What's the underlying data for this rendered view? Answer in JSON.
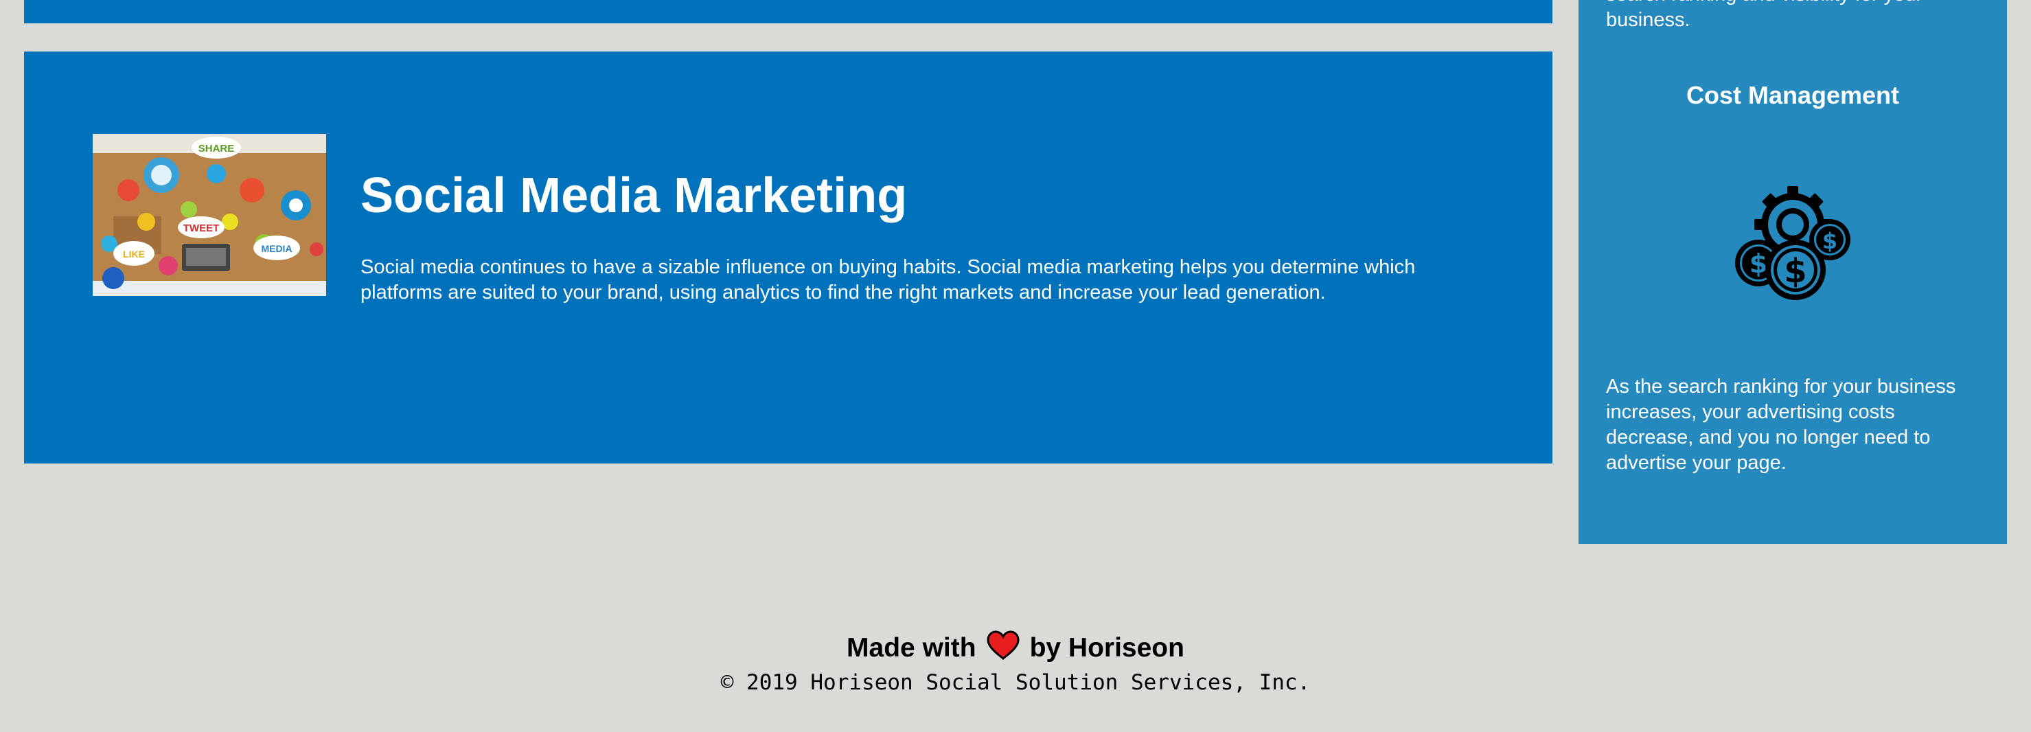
{
  "content": {
    "social_media": {
      "title": "Social Media Marketing",
      "text": "Social media continues to have a sizable influence on buying habits. Social media marketing helps you determine which platforms are suited to your brand, using analytics to find the right markets and increase your lead generation.",
      "image_icon": "social-media-collage-image",
      "bubble_labels": [
        "SHARE",
        "TWEET",
        "LIKE",
        "MEDIA"
      ]
    }
  },
  "sidebar": {
    "previous_text": "search ranking and visibility for your business.",
    "cost_management": {
      "title": "Cost Management",
      "icon": "gear-coins-icon",
      "text": "As the search ranking for your business increases, your advertising costs decrease, and you no longer need to advertise your page."
    }
  },
  "footer": {
    "made_with": "Made with",
    "by": "by Horiseon",
    "heart_icon": "heart-icon",
    "copyright": "© 2019 Horiseon Social Solution Services, Inc."
  },
  "colors": {
    "background": "#d9dcd6",
    "content_panel": "#0072bb",
    "sidebar_panel": "#2589bd",
    "heart": "#e81e1e",
    "text_light": "#ffffff",
    "text_dark": "#000000"
  }
}
